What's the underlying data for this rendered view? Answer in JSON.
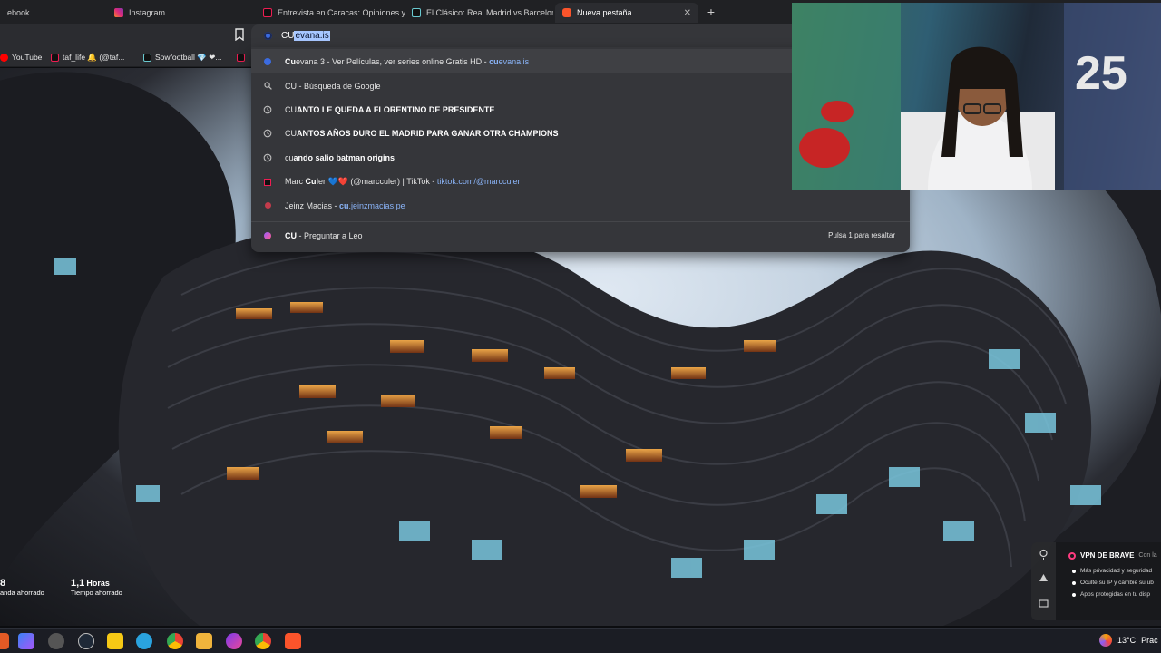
{
  "tabs": [
    {
      "label": "ebook",
      "icon": "facebook-icon",
      "active": false
    },
    {
      "label": "Instagram",
      "icon": "instagram-icon",
      "active": false
    },
    {
      "label": "Entrevista en Caracas: Opiniones y P",
      "icon": "tiktok-icon",
      "active": false
    },
    {
      "label": "El Clásico: Real Madrid vs Barcelona",
      "icon": "tiktok-icon",
      "active": false
    },
    {
      "label": "Nueva pestaña",
      "icon": "brave-icon",
      "active": true
    }
  ],
  "omnibox": {
    "typed": "CU",
    "autocomplete": "evana.is"
  },
  "bookmarks": [
    {
      "label": "YouTube",
      "icon": "youtube-icon"
    },
    {
      "label": "taf_life 🔔 (@taf...",
      "icon": "tiktok-icon"
    },
    {
      "label": "Sowfootball 💎 ❤...",
      "icon": "tiktok-icon"
    }
  ],
  "suggestions": [
    {
      "icon": "brave-search-icon",
      "bold": "Cu",
      "rest": "evana 3 - Ver Películas, ver series online Gratis HD - ",
      "url_bold": "cu",
      "url_rest": "evana.is",
      "highlighted": true
    },
    {
      "icon": "search-icon",
      "bold": "",
      "rest": "CU - Búsqueda de Google",
      "url_bold": "",
      "url_rest": "",
      "highlighted": false
    },
    {
      "icon": "history-icon",
      "bold": "ANTO LE QUEDA A FLORENTINO DE PRESIDENTE",
      "prefix": "CU",
      "highlighted": false
    },
    {
      "icon": "history-icon",
      "bold": "ANTOS AÑOS DURO EL MADRID PARA GANAR OTRA CHAMPIONS",
      "prefix": "CU",
      "highlighted": false
    },
    {
      "icon": "history-icon",
      "bold": "ando salio batman origins",
      "prefix": "cu",
      "highlighted": false
    },
    {
      "icon": "tiktok-icon",
      "pre": "Marc ",
      "bold": "Cul",
      "rest": "er 💙❤️ (@marcculer) | TikTok - ",
      "url_rest": "tiktok.com/@marcculer",
      "highlighted": false
    },
    {
      "icon": "site-icon",
      "pre": "Jeinz Macias - ",
      "url_bold": "cu",
      "url_rest": ".jeinzmacias.pe",
      "highlighted": false
    },
    {
      "icon": "leo-icon",
      "bold": "CU",
      "rest": " - Preguntar a Leo",
      "hint": "Pulsa 1 para resaltar",
      "highlighted": false
    }
  ],
  "stats": [
    {
      "value": "8",
      "caption": "anda ahorrado"
    },
    {
      "value": "1,1",
      "unit": "Horas",
      "caption": "Tiempo ahorrado"
    }
  ],
  "vpn": {
    "title": "VPN DE BRAVE",
    "tag": "Con la",
    "lines": [
      "Más privacidad y seguridad",
      "Oculte su IP y cambie su ub",
      "Apps protegidas en tu disp"
    ]
  },
  "tray": {
    "temperature": "13°C",
    "weather": "Prac"
  },
  "colors": {
    "accent": "#8ab4f8",
    "selection": "#a7c7ff",
    "brave": "#fb542b"
  }
}
